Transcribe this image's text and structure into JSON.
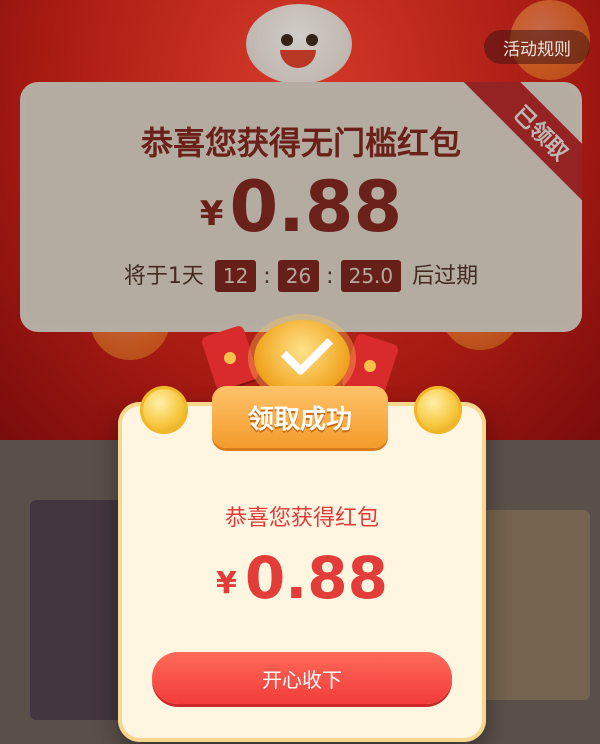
{
  "top": {
    "rules_label": "活动规则",
    "envelope": {
      "status_ribbon": "已领取",
      "title": "恭喜您获得无门槛红包",
      "currency": "¥",
      "amount": "0.88",
      "timer": {
        "prefix": "将于1天",
        "hours": "12",
        "minutes": "26",
        "seconds": "25.0",
        "suffix": "后过期"
      }
    }
  },
  "popup": {
    "banner_label": "领取成功",
    "subtitle": "恭喜您获得红包",
    "currency": "¥",
    "amount": "0.88",
    "accept_button": "开心收下"
  },
  "colors": {
    "accent_red": "#e33d3a",
    "popup_bg": "#fff6e2",
    "banner_orange": "#f39b2b"
  },
  "icons": [
    "check-icon",
    "coin-icon",
    "red-envelope-icon",
    "mascot-icon"
  ]
}
